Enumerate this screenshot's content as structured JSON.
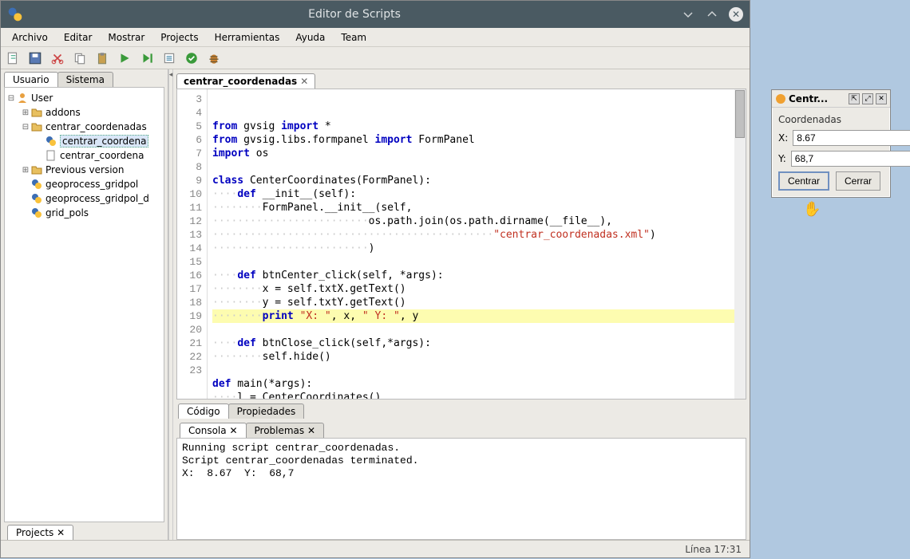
{
  "window": {
    "title": "Editor de Scripts"
  },
  "menu": {
    "items": [
      "Archivo",
      "Editar",
      "Mostrar",
      "Projects",
      "Herramientas",
      "Ayuda",
      "Team"
    ]
  },
  "sidebar": {
    "tabs": {
      "user": "Usuario",
      "system": "Sistema"
    },
    "root": "User",
    "items": [
      {
        "label": "addons",
        "type": "folder",
        "expandable": true
      },
      {
        "label": "centrar_coordenadas",
        "type": "folder",
        "expanded": true,
        "children": [
          {
            "label": "centrar_coordenadas",
            "type": "py",
            "selected": true,
            "trunc": "centrar_coordena"
          },
          {
            "label": "centrar_coordenadas",
            "type": "doc",
            "trunc": "centrar_coordena"
          }
        ]
      },
      {
        "label": "Previous version",
        "type": "folder",
        "expandable": true
      },
      {
        "label": "geoprocess_gridpol",
        "type": "py"
      },
      {
        "label": "geoprocess_gridpol_d",
        "type": "py"
      },
      {
        "label": "grid_pols",
        "type": "py"
      }
    ]
  },
  "editor": {
    "tab": "centrar_coordenadas",
    "mid_tabs": {
      "code": "Código",
      "props": "Propiedades"
    },
    "lines": [
      3,
      4,
      5,
      6,
      7,
      8,
      9,
      10,
      11,
      12,
      13,
      14,
      15,
      16,
      17,
      18,
      19,
      20,
      21,
      22,
      23
    ],
    "highlight_line": 17
  },
  "code": {
    "l3": {
      "kw1": "from",
      "t1": " gvsig ",
      "kw2": "import",
      "t2": " *"
    },
    "l4": {
      "kw1": "from",
      "t1": " gvsig.libs.formpanel ",
      "kw2": "import",
      "t2": " FormPanel"
    },
    "l5": {
      "kw1": "import",
      "t1": " os"
    },
    "l7": {
      "kw1": "class",
      "t1": " CenterCoordinates(FormPanel):"
    },
    "l8": {
      "dots": "····",
      "kw1": "def",
      "t1": " __init__(self):"
    },
    "l9": {
      "dots": "········",
      "t1": "FormPanel.__init__(self,"
    },
    "l10": {
      "dots": "·························",
      "t1": "os.path.join(os.path.dirname(__file__),"
    },
    "l11": {
      "dots": "·············································",
      "str": "\"centrar_coordenadas.xml\"",
      "t1": ")"
    },
    "l12": {
      "dots": "·························",
      "t1": ")"
    },
    "l14": {
      "dots": "····",
      "kw1": "def",
      "t1": " btnCenter_click(self, *args):"
    },
    "l15": {
      "dots": "········",
      "t1": "x = self.txtX.getText()"
    },
    "l16": {
      "dots": "········",
      "t1": "y = self.txtY.getText()"
    },
    "l17": {
      "dots": "········",
      "kw1": "print ",
      "str1": "\"X: \"",
      "t1": ", x, ",
      "str2": "\" Y: \"",
      "t2": ", y"
    },
    "l19": {
      "dots": "····",
      "kw1": "def",
      "t1": " btnClose_click(self,*args):"
    },
    "l20": {
      "dots": "········",
      "t1": "self.hide()"
    },
    "l22": {
      "kw1": "def",
      "t1": " main(*args):"
    },
    "l23": {
      "dots": "····",
      "t1": "l = CenterCoordinates()"
    }
  },
  "console": {
    "tabs": {
      "console": "Consola",
      "problems": "Problemas"
    },
    "text": "Running script centrar_coordenadas.\nScript centrar_coordenadas terminated.\nX:  8.67  Y:  68,7"
  },
  "bottom_tab": "Projects",
  "status": "Línea 17:31",
  "dialog": {
    "title": "Centr...",
    "subtitle": "Coordenadas",
    "x_label": "X:",
    "y_label": "Y:",
    "x_value": "8.67",
    "y_value": "68,7",
    "btn_center": "Centrar",
    "btn_close": "Cerrar"
  }
}
